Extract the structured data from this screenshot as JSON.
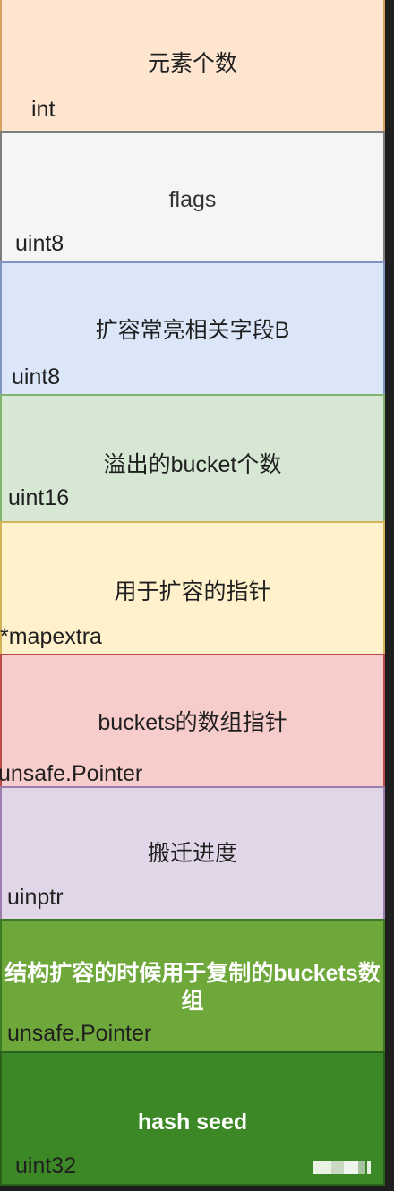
{
  "fields": [
    {
      "label": "元素个数",
      "type": "int"
    },
    {
      "label": "flags",
      "type": "uint8"
    },
    {
      "label": "扩容常亮相关字段B",
      "type": "uint8"
    },
    {
      "label": "溢出的bucket个数",
      "type": "uint16"
    },
    {
      "label": "用于扩容的指针",
      "type": "*mapextra"
    },
    {
      "label": "buckets的数组指针",
      "type": "unsafe.Pointer"
    },
    {
      "label": "搬迁进度",
      "type": "uinptr"
    },
    {
      "label": "结构扩容的时候用于复制的buckets数组",
      "type": "unsafe.Pointer"
    },
    {
      "label": "hash seed",
      "type": "uint32"
    }
  ],
  "colors": {
    "count": "#fde5cf",
    "flags": "#f5f5f5",
    "b": "#dbe7f8",
    "overflow": "#d6e8d4",
    "extra": "#fff1cb",
    "buckets": "#f7cdcb",
    "evacuate": "#e0d6e8",
    "oldbuckets": "#6fa83a",
    "hash_seed": "#3d8826",
    "background": "#1e1e1e"
  }
}
